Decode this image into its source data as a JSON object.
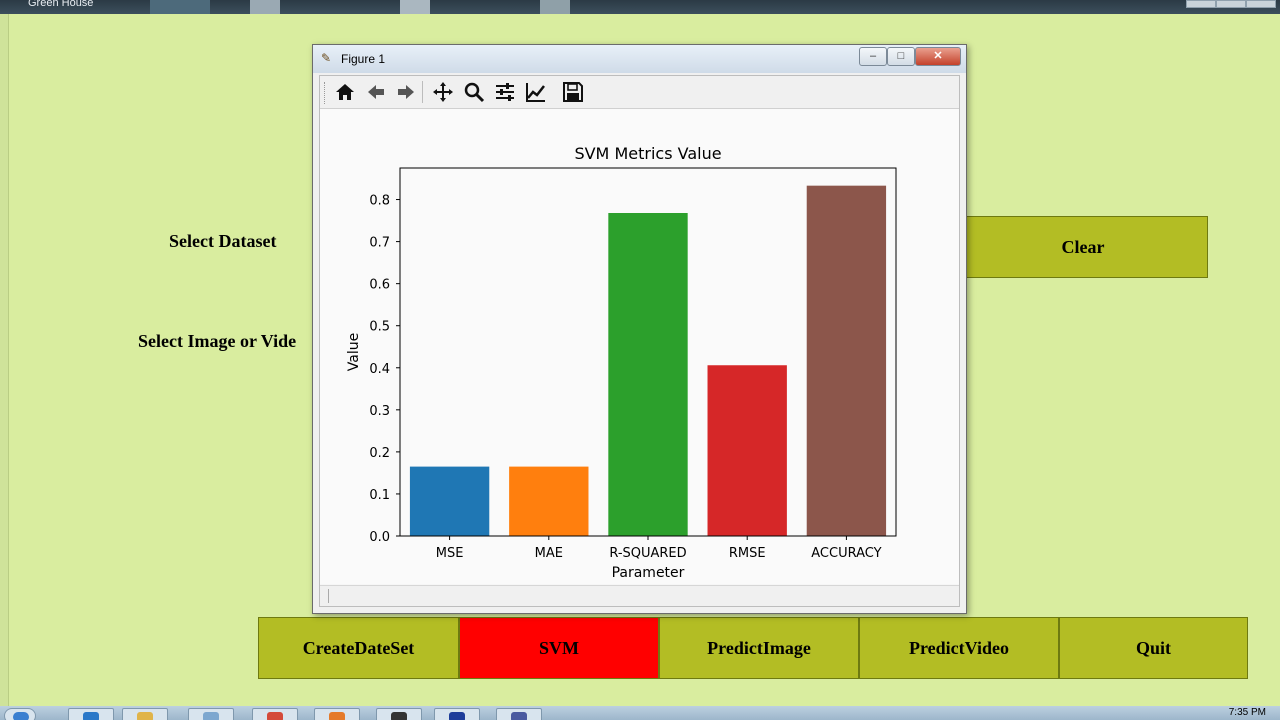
{
  "main_window": {
    "title": "Green House"
  },
  "labels": {
    "select_dataset": "Select Dataset",
    "select_image_video": "Select Image or Vide"
  },
  "buttons": {
    "clear": "Clear",
    "create_dataset": "CreateDateSet",
    "svm": "SVM",
    "predict_image": "PredictImage",
    "predict_video": "PredictVideo",
    "quit": "Quit"
  },
  "figure_window": {
    "title": "Figure 1",
    "minimize": "–",
    "maximize": "□",
    "close": "✕",
    "toolbar_tools": [
      "home-icon",
      "back-arrow-icon",
      "forward-arrow-icon",
      "pan-icon",
      "zoom-icon",
      "subplots-icon",
      "axes-edit-icon",
      "save-icon"
    ]
  },
  "chart_data": {
    "type": "bar",
    "title": "SVM Metrics Value",
    "xlabel": "Parameter",
    "ylabel": "Value",
    "categories": [
      "MSE",
      "MAE",
      "R-SQUARED",
      "RMSE",
      "ACCURACY"
    ],
    "values": [
      0.165,
      0.165,
      0.768,
      0.406,
      0.833
    ],
    "colors": [
      "#1f77b4",
      "#ff7f0e",
      "#2ca02c",
      "#d62728",
      "#8c564b"
    ],
    "yticks": [
      "0.0",
      "0.1",
      "0.2",
      "0.3",
      "0.4",
      "0.5",
      "0.6",
      "0.7",
      "0.8"
    ],
    "ylim": [
      0,
      0.875
    ],
    "grid": false
  },
  "taskbar": {
    "clock": "7:35 PM"
  },
  "colors": {
    "background": "#d9ed9f",
    "button": "#b3bd24",
    "active_button": "#ff0000"
  }
}
